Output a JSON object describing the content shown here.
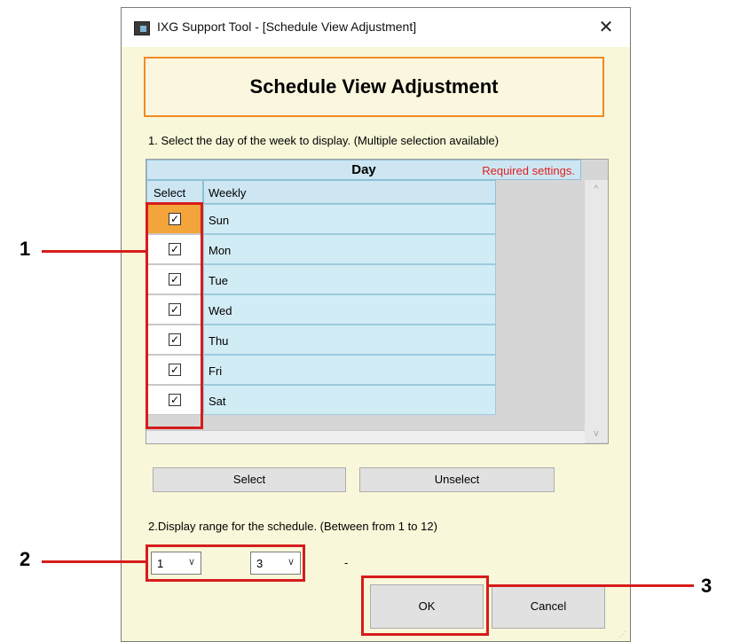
{
  "window": {
    "title": "IXG Support Tool - [Schedule View Adjustment]",
    "close_glyph": "✕"
  },
  "header": {
    "title": "Schedule View Adjustment"
  },
  "step1": {
    "instruction": "1. Select the day of the week to display. (Multiple selection available)"
  },
  "day_table": {
    "group_header": "Day",
    "required_note": "Required settings.",
    "columns": [
      "Select",
      "Weekly"
    ],
    "rows": [
      {
        "label": "Sun",
        "checked": true,
        "active": true
      },
      {
        "label": "Mon",
        "checked": true,
        "active": false
      },
      {
        "label": "Tue",
        "checked": true,
        "active": false
      },
      {
        "label": "Wed",
        "checked": true,
        "active": false
      },
      {
        "label": "Thu",
        "checked": true,
        "active": false
      },
      {
        "label": "Fri",
        "checked": true,
        "active": false
      },
      {
        "label": "Sat",
        "checked": true,
        "active": false
      }
    ],
    "check_glyph": "✓",
    "scroll_up_glyph": "^",
    "scroll_down_glyph": "v"
  },
  "buttons": {
    "select": "Select",
    "unselect": "Unselect",
    "ok": "OK",
    "cancel": "Cancel"
  },
  "step2": {
    "instruction": "2.Display range for the schedule. (Between from 1 to 12)",
    "from_value": "1",
    "separator": "-",
    "to_value": "3",
    "chevron": "∨"
  },
  "callouts": {
    "one": "1",
    "two": "2",
    "three": "3"
  },
  "colors": {
    "accent_orange": "#f08a24",
    "annotation_red": "#d61c1c",
    "window_bg": "#f8f7d9",
    "grid_blue": "#d2ecf5"
  }
}
